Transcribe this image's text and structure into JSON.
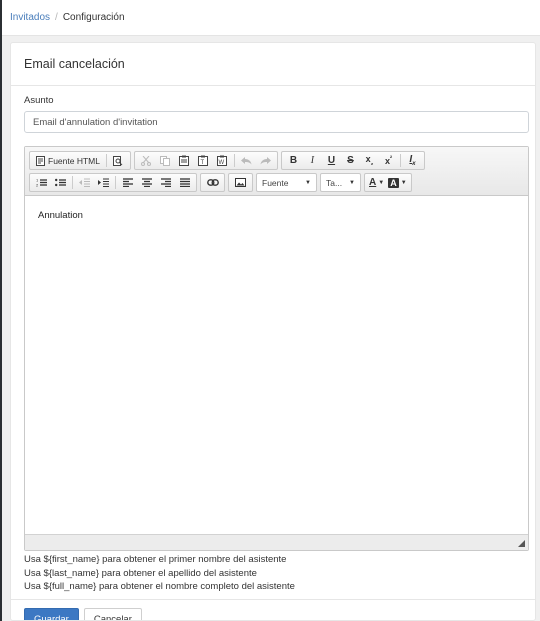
{
  "breadcrumb": {
    "parent": "Invitados",
    "separator": "/",
    "current": "Configuración"
  },
  "panel": {
    "title": "Email cancelación"
  },
  "subject": {
    "label": "Asunto",
    "value": "Email d'annulation d'invitation"
  },
  "toolbar": {
    "source_label": "Fuente HTML",
    "font_combo": "Fuente",
    "size_combo": "Ta...",
    "icons": [
      "source-icon",
      "preview-icon",
      "cut-icon",
      "copy-icon",
      "paste-icon",
      "paste-text-icon",
      "paste-word-icon",
      "undo-icon",
      "redo-icon",
      "bold-icon",
      "italic-icon",
      "underline-icon",
      "strikethrough-icon",
      "subscript-icon",
      "superscript-icon",
      "remove-format-icon",
      "numbered-list-icon",
      "bulleted-list-icon",
      "outdent-icon",
      "indent-icon",
      "align-left-icon",
      "align-center-icon",
      "align-right-icon",
      "justify-icon",
      "link-icon",
      "image-icon",
      "text-color-icon",
      "background-color-icon"
    ]
  },
  "editor": {
    "content": "Annulation"
  },
  "help": {
    "line1": "Usa ${first_name} para obtener el primer nombre del asistente",
    "line2": "Usa ${last_name} para obtener el apellido del asistente",
    "line3": "Usa ${full_name} para obtener el nombre completo del asistente"
  },
  "actions": {
    "save": "Guardar",
    "cancel": "Cancelar"
  },
  "colors": {
    "link": "#4a7ebb",
    "primary": "#3c78c3"
  }
}
